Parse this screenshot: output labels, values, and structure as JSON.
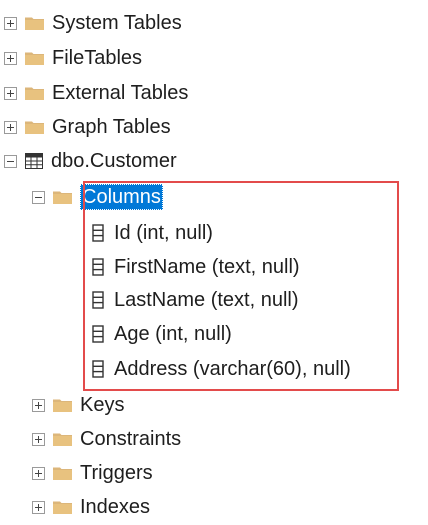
{
  "tree": {
    "top_items": [
      {
        "label": "System Tables",
        "expander": "plus",
        "icon": "folder-icon"
      },
      {
        "label": "FileTables",
        "expander": "plus",
        "icon": "folder-icon"
      },
      {
        "label": "External Tables",
        "expander": "plus",
        "icon": "folder-icon"
      },
      {
        "label": "Graph Tables",
        "expander": "plus",
        "icon": "folder-icon"
      }
    ],
    "table": {
      "label": "dbo.Customer",
      "expander": "minus",
      "icon": "table-icon",
      "columns_folder": {
        "label": "Columns",
        "expander": "minus",
        "icon": "folder-icon",
        "selected": true,
        "items": [
          {
            "label": "Id (int, null)",
            "icon": "column-icon"
          },
          {
            "label": "FirstName (text, null)",
            "icon": "column-icon"
          },
          {
            "label": "LastName (text, null)",
            "icon": "column-icon"
          },
          {
            "label": "Age (int, null)",
            "icon": "column-icon"
          },
          {
            "label": "Address (varchar(60), null)",
            "icon": "column-icon"
          }
        ]
      },
      "child_folders": [
        {
          "label": "Keys",
          "expander": "plus",
          "icon": "folder-icon"
        },
        {
          "label": "Constraints",
          "expander": "plus",
          "icon": "folder-icon"
        },
        {
          "label": "Triggers",
          "expander": "plus",
          "icon": "folder-icon"
        },
        {
          "label": "Indexes",
          "expander": "plus",
          "icon": "folder-icon"
        }
      ]
    }
  },
  "colors": {
    "folder": "#dcb67a",
    "selection": "#0078d7",
    "highlight_border": "#e34b4b",
    "expander_border": "#9a9a9a"
  }
}
